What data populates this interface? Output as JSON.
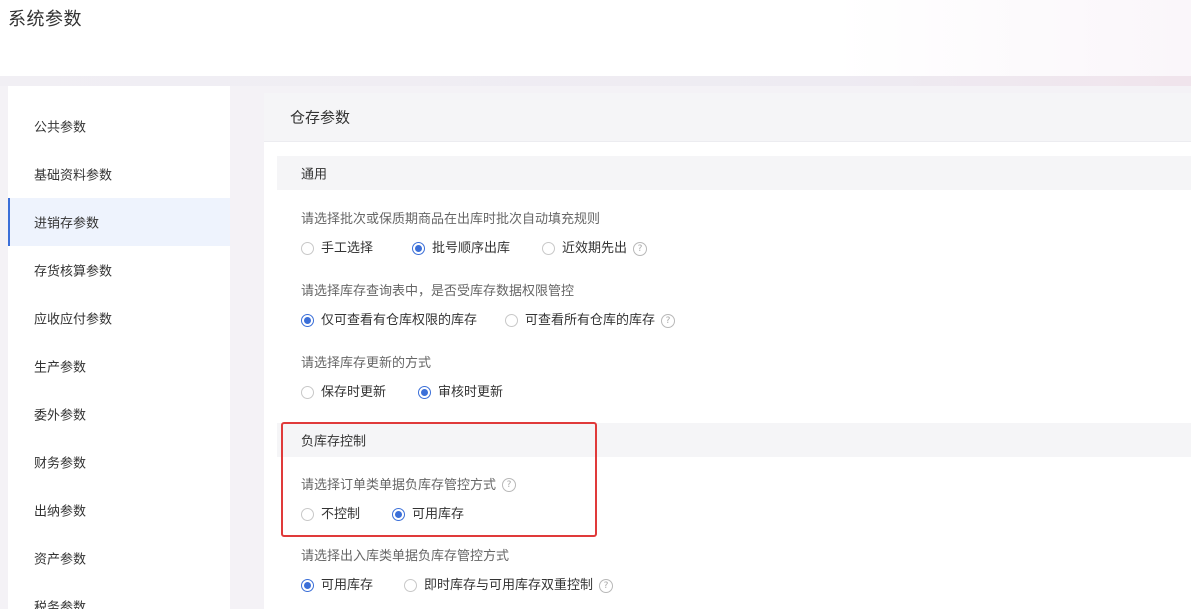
{
  "page": {
    "title": "系统参数"
  },
  "sidebar": {
    "items": [
      {
        "label": "公共参数",
        "active": false
      },
      {
        "label": "基础资料参数",
        "active": false
      },
      {
        "label": "进销存参数",
        "active": true
      },
      {
        "label": "存货核算参数",
        "active": false
      },
      {
        "label": "应收应付参数",
        "active": false
      },
      {
        "label": "生产参数",
        "active": false
      },
      {
        "label": "委外参数",
        "active": false
      },
      {
        "label": "财务参数",
        "active": false
      },
      {
        "label": "出纳参数",
        "active": false
      },
      {
        "label": "资产参数",
        "active": false
      },
      {
        "label": "税务参数",
        "active": false
      }
    ]
  },
  "content": {
    "title": "仓存参数",
    "sections": [
      {
        "title": "通用",
        "questions": [
          {
            "text": "请选择批次或保质期商品在出库时批次自动填充规则",
            "options": [
              "手工选择",
              "批号顺序出库",
              "近效期先出"
            ],
            "selected": 1,
            "help_icon": "question-circle-icon"
          },
          {
            "text": "请选择库存查询表中，是否受库存数据权限管控",
            "options": [
              "仅可查看有仓库权限的库存",
              "可查看所有仓库的库存"
            ],
            "selected": 0,
            "help_icon": "question-circle-icon"
          },
          {
            "text": "请选择库存更新的方式",
            "options": [
              "保存时更新",
              "审核时更新"
            ],
            "selected": 1
          }
        ]
      },
      {
        "title": "负库存控制",
        "questions": [
          {
            "text": "请选择订单类单据负库存管控方式",
            "options": [
              "不控制",
              "可用库存"
            ],
            "selected": 1,
            "help_icon": "question-circle-icon"
          },
          {
            "text": "请选择出入库类单据负库存管控方式",
            "options": [
              "可用库存",
              "即时库存与可用库存双重控制"
            ],
            "selected": 0,
            "help_icon": "question-circle-icon"
          }
        ]
      }
    ]
  },
  "colors": {
    "accent": "#3b6fd8",
    "highlight_border": "#e03a3a"
  }
}
